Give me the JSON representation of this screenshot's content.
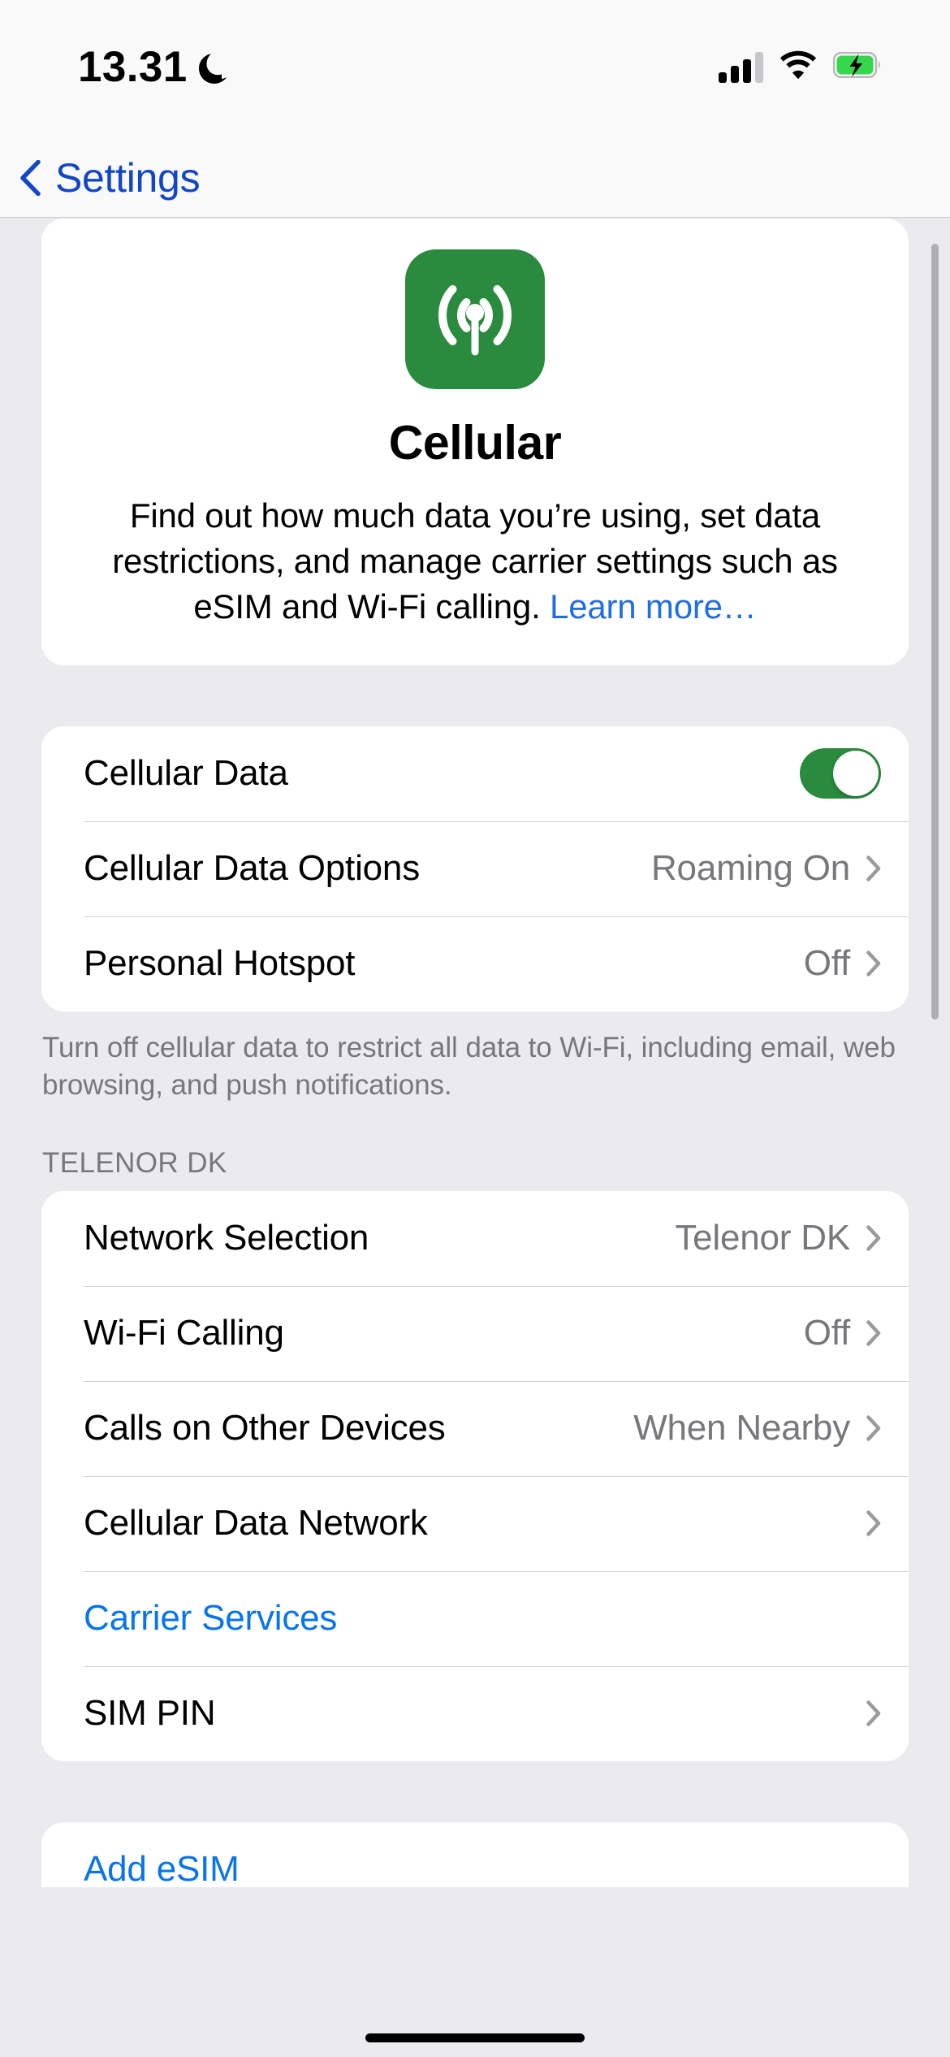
{
  "status_bar": {
    "time": "13.31",
    "dnd_icon": "moon-icon",
    "signal_icon": "cellular-signal-icon",
    "wifi_icon": "wifi-icon",
    "battery_icon": "battery-charging-icon"
  },
  "nav": {
    "back_label": "Settings",
    "back_icon": "chevron-left-icon"
  },
  "hero": {
    "icon_name": "cellular-app-icon",
    "icon_color": "#2a8a3e",
    "title": "Cellular",
    "description": "Find out how much data you’re using, set data restrictions, and manage carrier settings such as eSIM and Wi‑Fi calling. ",
    "link_label": "Learn more…"
  },
  "data_group": {
    "rows": [
      {
        "label": "Cellular Data",
        "control": "toggle",
        "toggle_on": true
      },
      {
        "label": "Cellular Data Options",
        "value": "Roaming On",
        "control": "chevron"
      },
      {
        "label": "Personal Hotspot",
        "value": "Off",
        "control": "chevron"
      }
    ],
    "footer": "Turn off cellular data to restrict all data to Wi‑Fi, including email, web browsing, and push notifications."
  },
  "carrier_group": {
    "header": "TELENOR DK",
    "rows": [
      {
        "label": "Network Selection",
        "value": "Telenor DK",
        "control": "chevron"
      },
      {
        "label": "Wi‑Fi Calling",
        "value": "Off",
        "control": "chevron"
      },
      {
        "label": "Calls on Other Devices",
        "value": "When Nearby",
        "control": "chevron"
      },
      {
        "label": "Cellular Data Network",
        "value": "",
        "control": "chevron"
      },
      {
        "label": "Carrier Services",
        "value": "",
        "control": "none",
        "style": "link"
      },
      {
        "label": "SIM PIN",
        "value": "",
        "control": "chevron"
      }
    ]
  },
  "esim_group": {
    "rows": [
      {
        "label": "Add eSIM",
        "style": "link"
      }
    ]
  },
  "colors": {
    "accent_blue": "#0a74ea",
    "nav_blue": "#1246c4",
    "toggle_green": "#2a8a3e",
    "page_bg": "#ebebef",
    "card_bg": "#ffffff",
    "secondary_text": "#77777c"
  }
}
